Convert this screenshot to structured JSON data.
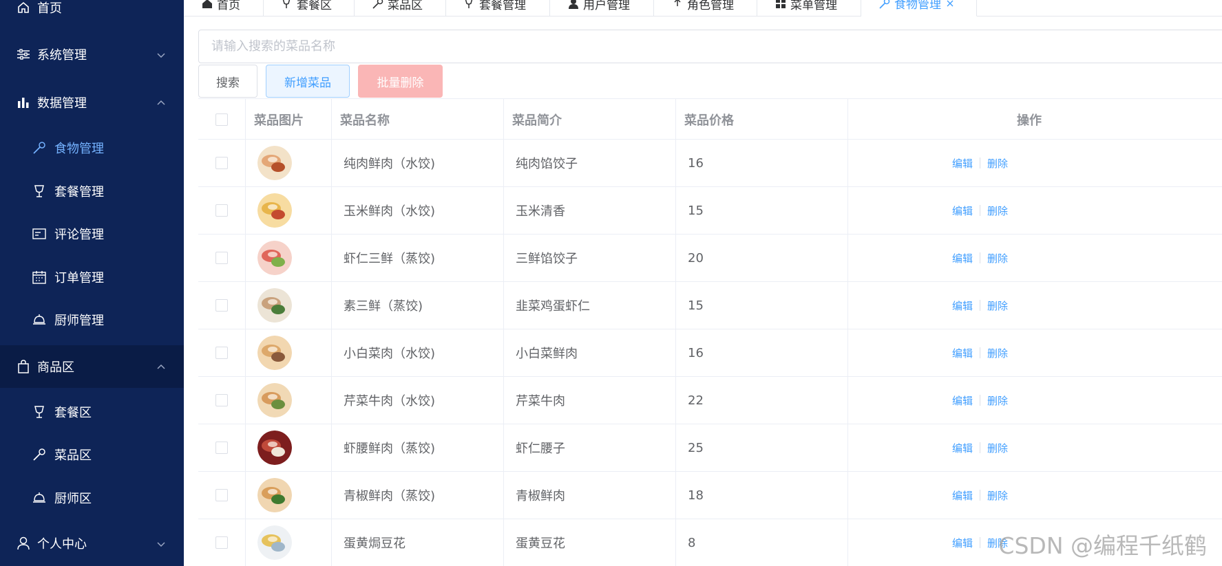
{
  "sidebar": {
    "items": [
      {
        "label": "首页",
        "icon": "home-icon"
      },
      {
        "label": "系统管理",
        "icon": "sliders-icon"
      },
      {
        "label": "数据管理",
        "icon": "bar-chart-icon"
      },
      {
        "label": "食物管理",
        "icon": "spoon-icon"
      },
      {
        "label": "套餐管理",
        "icon": "cup-icon"
      },
      {
        "label": "评论管理",
        "icon": "card-icon"
      },
      {
        "label": "订单管理",
        "icon": "calendar-icon"
      },
      {
        "label": "厨师管理",
        "icon": "cloche-icon"
      },
      {
        "label": "商品区",
        "icon": "bag-icon"
      },
      {
        "label": "套餐区",
        "icon": "cup-icon"
      },
      {
        "label": "菜品区",
        "icon": "spoon-icon"
      },
      {
        "label": "厨师区",
        "icon": "cloche-icon"
      },
      {
        "label": "个人中心",
        "icon": "user-icon"
      }
    ],
    "active_color": "#74b2ff",
    "bg_color": "#0e2457"
  },
  "tabs": [
    {
      "label": "首页"
    },
    {
      "label": "套餐区"
    },
    {
      "label": "菜品区"
    },
    {
      "label": "套餐管理"
    },
    {
      "label": "用户管理"
    },
    {
      "label": "角色管理"
    },
    {
      "label": "菜单管理"
    },
    {
      "label": "食物管理"
    }
  ],
  "search": {
    "placeholder": "请输入搜索的菜品名称",
    "search_label": "搜索",
    "add_label": "新增菜品",
    "batch_delete_label": "批量删除"
  },
  "table": {
    "headers": [
      "菜品图片",
      "菜品名称",
      "菜品简介",
      "菜品价格",
      "操作"
    ],
    "edit_label": "编辑",
    "delete_label": "删除",
    "rows": [
      {
        "name": "纯肉鲜肉（水饺)",
        "desc": "纯肉馅饺子",
        "price": "16"
      },
      {
        "name": "玉米鲜肉（水饺)",
        "desc": "玉米清香",
        "price": "15"
      },
      {
        "name": "虾仁三鲜（蒸饺)",
        "desc": "三鲜馅饺子",
        "price": "20"
      },
      {
        "name": "素三鲜（蒸饺)",
        "desc": "韭菜鸡蛋虾仁",
        "price": "15"
      },
      {
        "name": "小白菜肉（水饺)",
        "desc": "小白菜鲜肉",
        "price": "16"
      },
      {
        "name": "芹菜牛肉（水饺)",
        "desc": "芹菜牛肉",
        "price": "22"
      },
      {
        "name": "虾腰鲜肉（蒸饺)",
        "desc": "虾仁腰子",
        "price": "25"
      },
      {
        "name": "青椒鲜肉（蒸饺)",
        "desc": "青椒鲜肉",
        "price": "18"
      },
      {
        "name": "蛋黄焗豆花",
        "desc": "蛋黄豆花",
        "price": "8"
      }
    ]
  },
  "watermark": "CSDN @编程千纸鹤"
}
